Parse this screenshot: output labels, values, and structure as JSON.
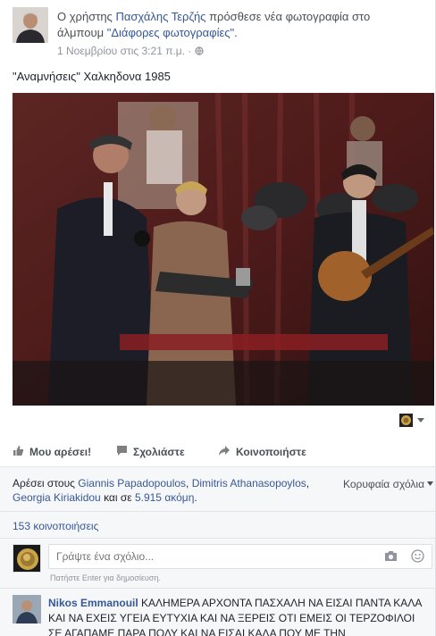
{
  "post": {
    "prefix": "Ο χρήστης",
    "author": "Πασχάλης Τερζής",
    "action": "πρόσθεσε νέα φωτογραφία στο άλμπουμ",
    "album": "\"Διάφορες φωτογραφίες\"",
    "suffix": ".",
    "timestamp": "1 Νοεμβρίου στις 3:21 π.μ.",
    "privacy_sep": "·",
    "privacy_icon": "globe-icon",
    "caption": "\"Αναμνήσεις\" Χαλκηδονα 1985"
  },
  "actions": {
    "like": "Μου αρέσει!",
    "comment": "Σχολιάστε",
    "share": "Κοινοποιήστε"
  },
  "reactions": {
    "prefix": "Αρέσει στους",
    "people": [
      "Giannis Papadopoulos",
      "Dimitris Athanasopoylos",
      "Georgia Kiriakidou"
    ],
    "sep1": ", ",
    "sep2": ", ",
    "and_text": "και σε",
    "others": "5.915 ακόμη",
    "end": ".",
    "top_comments": "Κορυφαία σχόλια",
    "shares": "153 κοινοποιήσεις"
  },
  "composer": {
    "placeholder": "Γράψτε ένα σχόλιο...",
    "hint": "Πατήστε Enter για δημοσίευση."
  },
  "comment": {
    "author": "Nikos Emmanouil",
    "text": "ΚΑΛΗΜΕΡΑ ΑΡΧΟΝΤΑ ΠΑΣΧΑΛΗ ΝΑ ΕΙΣΑΙ ΠΑΝΤΑ ΚΑΛΑ ΚΑΙ ΝΑ ΕΧΕΙΣ ΥΓΕΙΑ ΕΥΤΥΧΙΑ ΚΑΙ ΝΑ ΞΕΡΕΙΣ ΟΤΙ ΕΜΕΙΣ ΟΙ ΤΕΡΖΟΦΙΛΟΙ ΣΕ ΑΓΑΠΑΜΕ ΠΑΡΑ ΠΟΛΥ ΚΑΙ ΝΑ ΕΙΣΑΙ ΚΑΛΑ ΠΟΥ ΜΕ ΤΗΝ"
  },
  "colors": {
    "link": "#365899",
    "meta": "#90949c",
    "text": "#1d2129",
    "panel": "#f6f7f9"
  }
}
